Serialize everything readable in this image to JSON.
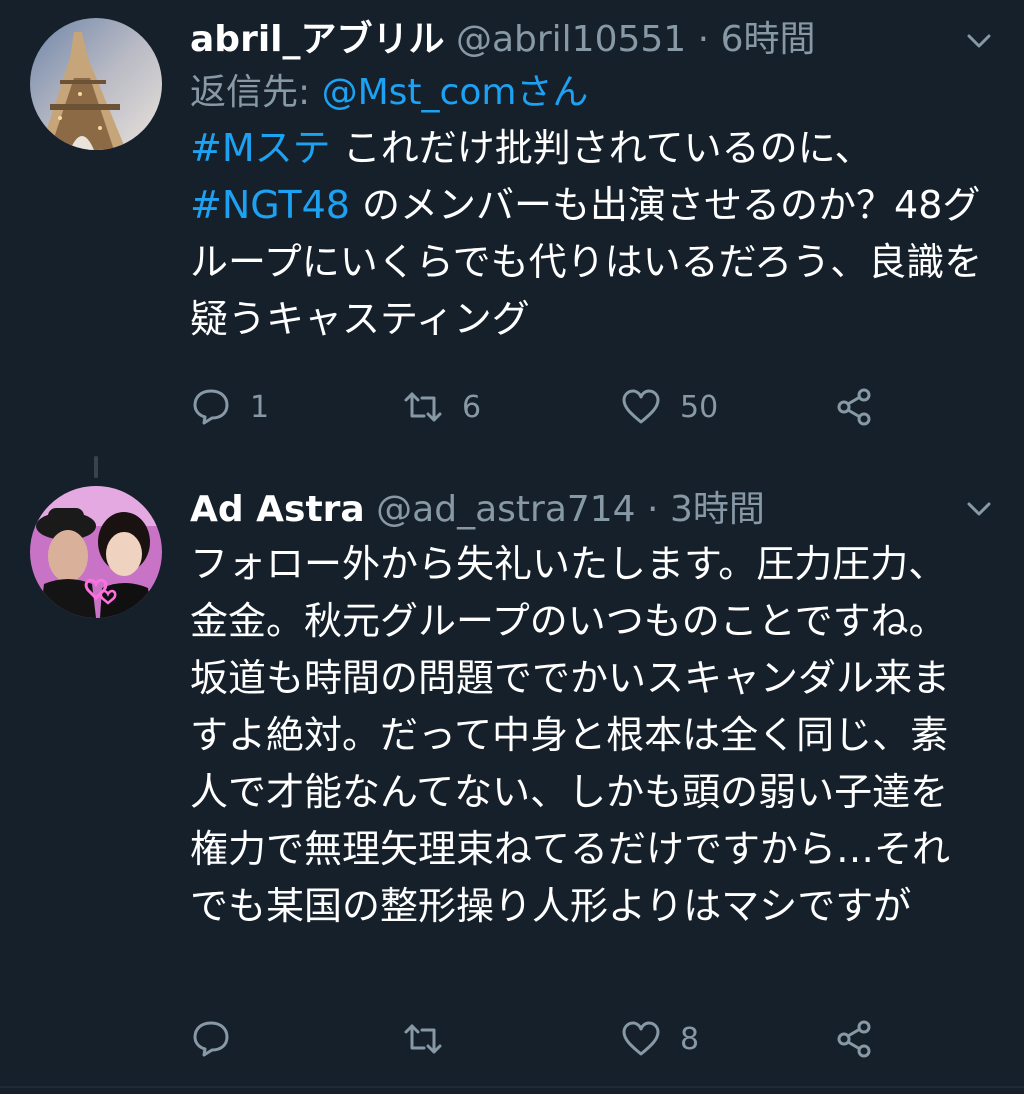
{
  "tweets": [
    {
      "display_name": "abril_アブリル",
      "handle": "@abril10551",
      "separator": "·",
      "time": "6時間",
      "reply_prefix": "返信先:",
      "reply_mention": "@Mst_comさん",
      "hashtag_1": "#Mステ",
      "text_1": " これだけ批判されているのに、",
      "hashtag_2": "#NGT48",
      "text_2": " のメンバーも出演させるのか？48グループにいくらでも代りはいるだろう、良識を疑うキャスティング",
      "replies": "1",
      "retweets": "6",
      "likes": "50"
    },
    {
      "display_name": "Ad Astra",
      "handle": "@ad_astra714",
      "separator": "·",
      "time": "3時間",
      "text": "フォロー外から失礼いたします。圧力圧力、金金。秋元グループのいつものことですね。坂道も時間の問題ででかいスキャンダル来ますよ絶対。だって中身と根本は全く同じ、素人で才能なんてない、しかも頭の弱い子達を権力で無理矢理束ねてるだけですから…それでも某国の整形操り人形よりはマシですが",
      "replies": "",
      "retweets": "",
      "likes": "8"
    }
  ],
  "icons": {
    "reply": "reply-icon",
    "retweet": "retweet-icon",
    "like": "like-icon",
    "share": "share-icon",
    "caret": "chevron-down-icon"
  },
  "colors": {
    "background": "#15202b",
    "link": "#1da1f2",
    "secondary_text": "#8899a6"
  }
}
